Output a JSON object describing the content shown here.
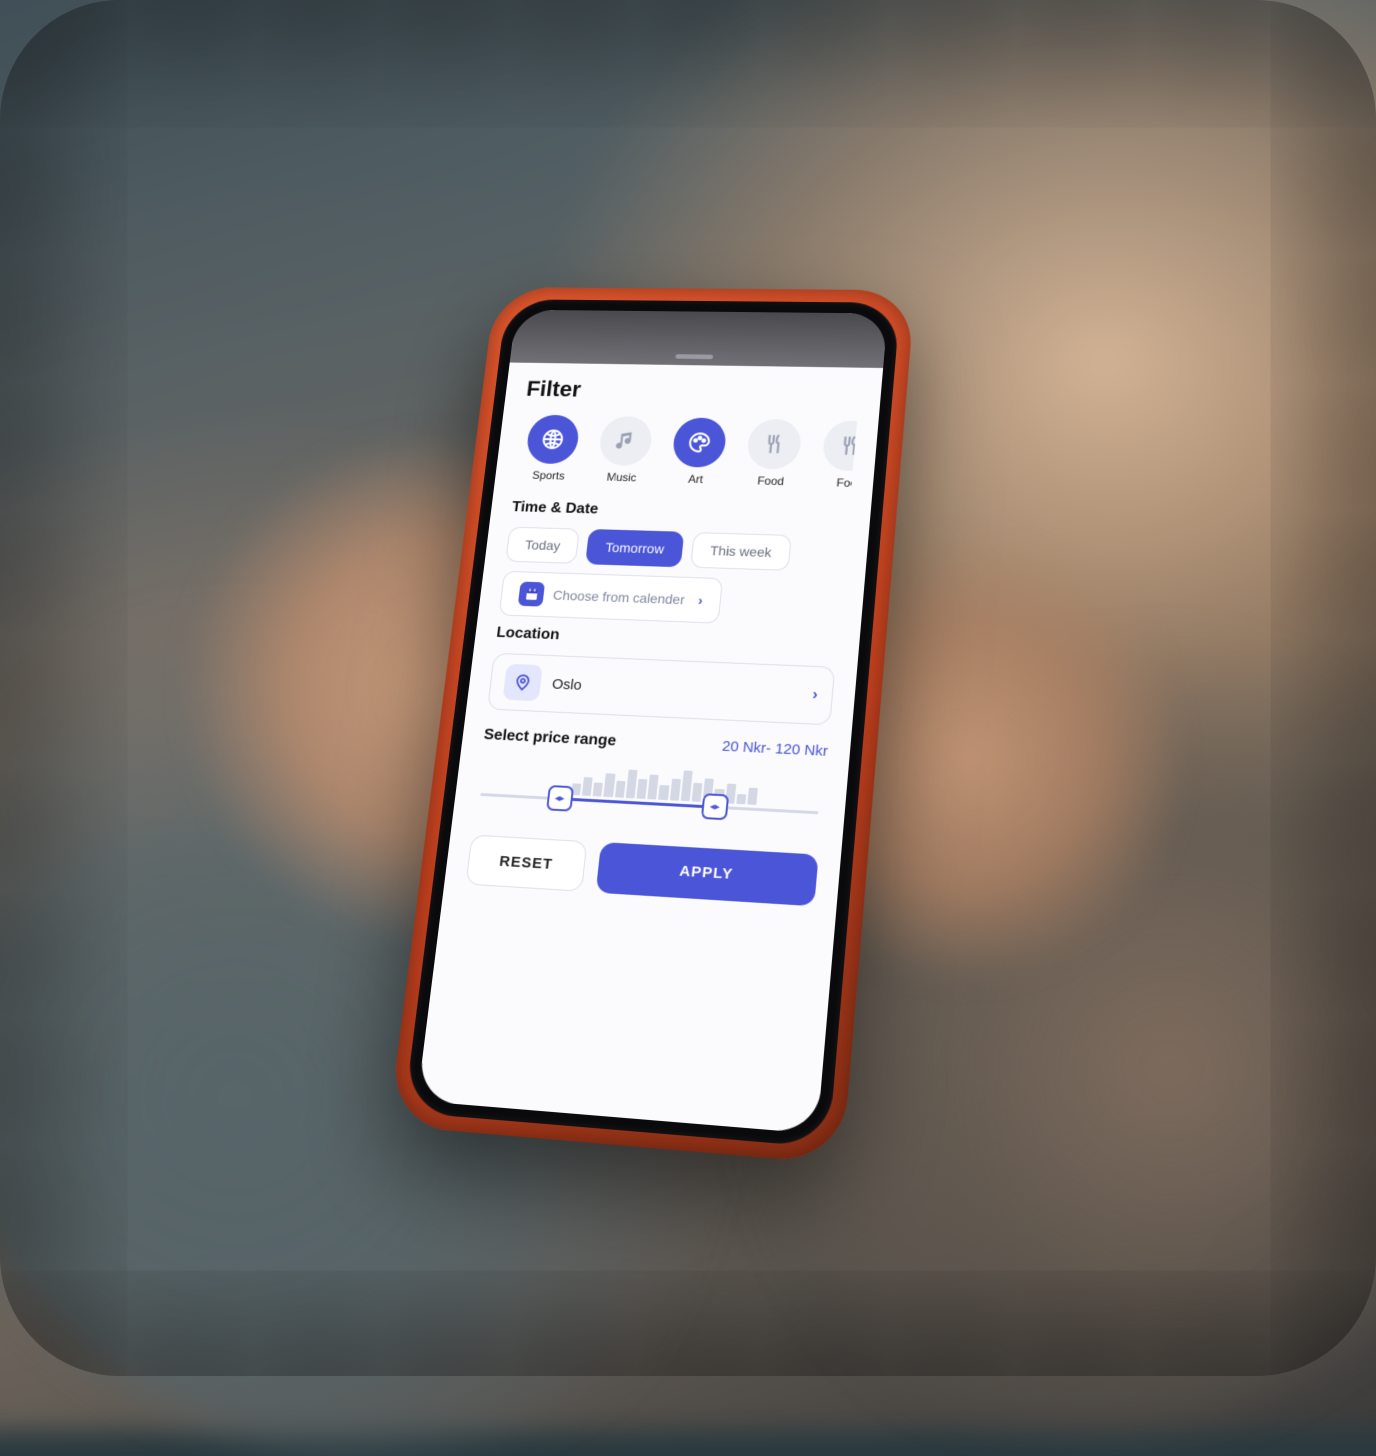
{
  "title": "Filter",
  "categories": [
    {
      "label": "Sports",
      "icon": "basketball-icon",
      "active": true
    },
    {
      "label": "Music",
      "icon": "music-icon",
      "active": false
    },
    {
      "label": "Art",
      "icon": "palette-icon",
      "active": true
    },
    {
      "label": "Food",
      "icon": "utensils-icon",
      "active": false
    },
    {
      "label": "Foo",
      "icon": "utensils-icon",
      "active": false
    }
  ],
  "time_date": {
    "heading": "Time & Date",
    "options": [
      "Today",
      "Tomorrow",
      "This week"
    ],
    "selected": "Tomorrow",
    "calendar_label": "Choose from calender"
  },
  "location": {
    "heading": "Location",
    "value": "Oslo"
  },
  "price": {
    "heading": "Select price range",
    "value_text": "20 Nkr- 120 Nkr",
    "min": 20,
    "max": 120,
    "currency": "Nkr"
  },
  "buttons": {
    "reset": "RESET",
    "apply": "APPLY"
  },
  "colors": {
    "primary": "#4b55d8",
    "border": "#dcdfe8",
    "muted": "#6b7080"
  }
}
